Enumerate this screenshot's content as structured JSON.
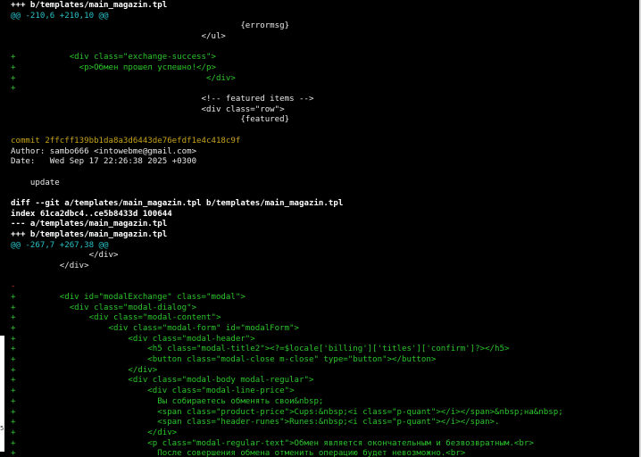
{
  "terminal": {
    "lines": [
      {
        "text": "+++ b/templates/main_magazin.tpl",
        "color": "bold"
      },
      {
        "text": "@@ -210,6 +210,10 @@",
        "color": "cyan"
      },
      {
        "text": "                                               {errormsg}",
        "color": "white"
      },
      {
        "text": "                                       </ul>",
        "color": "white"
      },
      {
        "text": "",
        "color": "white"
      },
      {
        "text": "+           <div class=\"exchange-success\">",
        "color": "green"
      },
      {
        "text": "+             <p>Обмен прошел успешно!</p>",
        "color": "green"
      },
      {
        "text": "+                                       </div>",
        "color": "green"
      },
      {
        "text": "+",
        "color": "green"
      },
      {
        "text": "                                       <!-- featured items -->",
        "color": "white"
      },
      {
        "text": "                                       <div class=\"row\">",
        "color": "white"
      },
      {
        "text": "                                               {featured}",
        "color": "white"
      },
      {
        "text": "",
        "color": "white"
      },
      {
        "text": "commit 2ffcff139bb1da8a3d6443de76efdf1e4c418c9f",
        "color": "yellow"
      },
      {
        "text": "Author: sambo666 <intowebme@gmail.com>",
        "color": "white"
      },
      {
        "text": "Date:   Wed Sep 17 22:26:38 2025 +0300",
        "color": "white"
      },
      {
        "text": "",
        "color": "white"
      },
      {
        "text": "    update",
        "color": "white"
      },
      {
        "text": "",
        "color": "white"
      },
      {
        "text": "diff --git a/templates/main_magazin.tpl b/templates/main_magazin.tpl",
        "color": "bold"
      },
      {
        "text": "index 61ca2dbc4..ce5b8433d 100644",
        "color": "bold"
      },
      {
        "text": "--- a/templates/main_magazin.tpl",
        "color": "bold"
      },
      {
        "text": "+++ b/templates/main_magazin.tpl",
        "color": "bold"
      },
      {
        "text": "@@ -267,7 +267,38 @@",
        "color": "cyan"
      },
      {
        "text": "                </div>",
        "color": "white"
      },
      {
        "text": "          </div>",
        "color": "white"
      },
      {
        "text": "",
        "color": "white"
      },
      {
        "text": "-",
        "color": "red"
      },
      {
        "text": "+         <div id=\"modalExchange\" class=\"modal\">",
        "color": "green"
      },
      {
        "text": "+           <div class=\"modal-dialog\">",
        "color": "green"
      },
      {
        "text": "+               <div class=\"modal-content\">",
        "color": "green"
      },
      {
        "text": "+                   <div class=\"modal-form\" id=\"modalForm\">",
        "color": "green"
      },
      {
        "text": "+                       <div class=\"modal-header\">",
        "color": "green"
      },
      {
        "text": "+                           <h5 class=\"modal-title2\"><?=$locale['billing']['titles']['confirm']?></h5>",
        "color": "green"
      },
      {
        "text": "+                           <button class=\"modal-close m-close\" type=\"button\"></button>",
        "color": "green"
      },
      {
        "text": "+                       </div>",
        "color": "green"
      },
      {
        "text": "+                       <div class=\"modal-body modal-regular\">",
        "color": "green"
      },
      {
        "text": "+                           <div class=\"modal-line-price\">",
        "color": "green"
      },
      {
        "text": "+                             Вы собираетесь обменять свои&nbsp;",
        "color": "green"
      },
      {
        "text": "+                             <span class=\"product-price\">Cups:&nbsp;<i class=\"p-quant\"></i></span>&nbsp;на&nbsp;",
        "color": "green"
      },
      {
        "text": "+                             <span class=\"header-runes\">Runes:&nbsp;<i class=\"p-quant\"></i></span>.",
        "color": "green"
      },
      {
        "text": "+                           </div>",
        "color": "green"
      },
      {
        "text": "+                           <p class=\"modal-regular-text\">Обмен является окончательным и безвозвратным.<br>",
        "color": "green"
      },
      {
        "text": "+                             После совершения обмена отменить операцию будет невозможно.<br>",
        "color": "green"
      }
    ]
  },
  "edge": {
    "glyphs": [
      "",
      "",
      "5",
      ""
    ]
  }
}
